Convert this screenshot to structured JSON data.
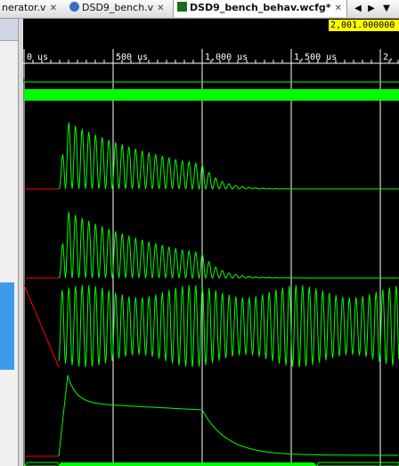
{
  "tabs": [
    {
      "label": "nerator.v",
      "close": "✕",
      "icon": "verilog-file-icon"
    },
    {
      "label": "DSD9_bench.v",
      "close": "✕",
      "icon": "verilog-file-icon"
    },
    {
      "label": "DSD9_bench_behav.wcfg*",
      "close": "✕",
      "icon": "waveform-config-icon",
      "active": true
    }
  ],
  "nav": {
    "prev": "◀",
    "next": "▶",
    "menu": "▼"
  },
  "cursor": {
    "value": "2,001.000000 us"
  },
  "time_axis": {
    "unit": "us",
    "ticks": [
      {
        "t": 0,
        "label": "0 us"
      },
      {
        "t": 500,
        "label": "500 us"
      },
      {
        "t": 1000,
        "label": "1,000 us"
      },
      {
        "t": 1500,
        "label": "1,500 us"
      },
      {
        "t": 2000,
        "label": "2,"
      }
    ]
  },
  "colors": {
    "wave": "#00ff00",
    "reset": "#ff0000",
    "grid": "#ffffff",
    "cursor_bg": "#ffff00",
    "selection": "#3d9be9"
  },
  "waveforms": [
    {
      "name": "bus-waveform",
      "kind": "bus"
    },
    {
      "name": "analog-waveform-1",
      "kind": "decaying-oscillation"
    },
    {
      "name": "analog-waveform-2",
      "kind": "decaying-oscillation"
    },
    {
      "name": "analog-waveform-3",
      "kind": "steady-oscillation"
    },
    {
      "name": "analog-waveform-4",
      "kind": "envelope"
    },
    {
      "name": "bus-waveform-bottom",
      "kind": "bus"
    }
  ]
}
